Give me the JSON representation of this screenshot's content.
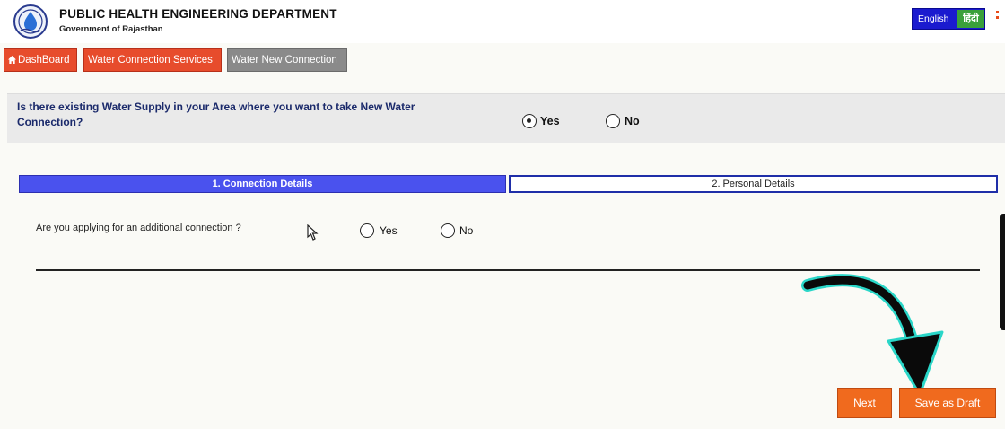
{
  "header": {
    "title": "PUBLIC HEALTH ENGINEERING DEPARTMENT",
    "subtitle": "Government of Rajasthan",
    "lang_english": "English",
    "lang_hindi": "हिंदी"
  },
  "nav": {
    "dashboard": "DashBoard",
    "water_connection_services": "Water Connection Services",
    "water_new_connection": "Water New Connection"
  },
  "supply_question": {
    "text": "Is there existing Water Supply in your Area where you want to take New Water Connection?",
    "yes_label": "Yes",
    "no_label": "No",
    "selected": "Yes"
  },
  "steps": {
    "step1": "1.  Connection Details",
    "step2": "2.  Personal Details",
    "active": 1
  },
  "additional_question": {
    "text": "Are you applying for an additional connection ?",
    "yes_label": "Yes",
    "no_label": "No"
  },
  "actions": {
    "next": "Next",
    "save_draft": "Save as Draft"
  },
  "colors": {
    "nav_active": "#e74c2c",
    "nav_current": "#8a8a8a",
    "step_active": "#4a52ee",
    "action": "#f06a1e",
    "lang": "#1a1acf"
  }
}
